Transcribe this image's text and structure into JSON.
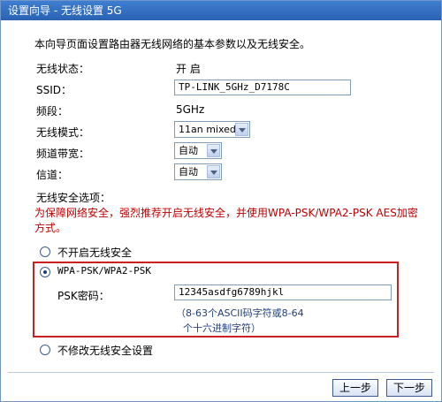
{
  "window": {
    "title": "设置向导 - 无线设置 5G"
  },
  "intro": "本向导页面设置路由器无线网络的基本参数以及无线安全。",
  "status": {
    "label": "无线状态：",
    "value": "开 启"
  },
  "ssid": {
    "label": "SSID：",
    "value": "TP-LINK_5GHz_D7178C"
  },
  "band": {
    "label": "频段：",
    "value": "5GHz"
  },
  "mode": {
    "label": "无线模式：",
    "selected": "11an mixed"
  },
  "bandwidth": {
    "label": "频道带宽：",
    "selected": "自动"
  },
  "channel": {
    "label": "信道：",
    "selected": "自动"
  },
  "security": {
    "section_label": "无线安全选项：",
    "warning": "为保障网络安全，强烈推荐开启无线安全，并使用WPA-PSK/WPA2-PSK AES加密方式。",
    "options": {
      "none": "不开启无线安全",
      "wpa": "WPA-PSK/WPA2-PSK",
      "keep": "不修改无线安全设置"
    },
    "selected": "wpa",
    "psk_label": "PSK密码：",
    "psk_value": "12345asdfg6789hjkl",
    "hint_line1": "（8-63个ASCII码字符或8-64",
    "hint_line2": "个十六进制字符）"
  },
  "buttons": {
    "prev": "上一步",
    "next": "下一步"
  }
}
